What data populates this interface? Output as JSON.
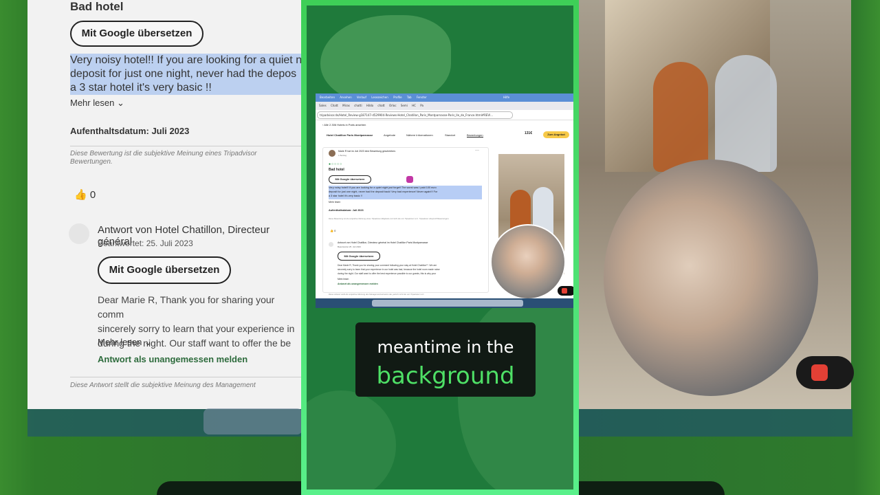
{
  "background_left": {
    "title": "Bad hotel",
    "translate_button": "Mit Google übersetzen",
    "review_lines": [
      "Very noisy hotel!! If you are looking for a quiet n",
      "deposit for just one night, never had the depos",
      "a 3 star hotel it's very basic !!"
    ],
    "read_more": "Mehr lesen",
    "stay_date": "Aufenthaltsdatum: Juli 2023",
    "disclaimer_lines": [
      "Diese Bewertung ist die subjektive Meinung eines Tripadvisor",
      "Bewertungen."
    ],
    "like_count": "0",
    "response_title": "Antwort von Hotel Chatillon, Directeur général",
    "response_date": "Beantwortet: 25. Juli 2023",
    "translate_button_2": "Mit Google übersetzen",
    "response_lines": [
      "Dear Marie R, Thank you for sharing your comm",
      "sincerely sorry to learn that your experience in",
      "during the night. Our staff want to offer the be"
    ],
    "read_more_2": "Mehr lesen",
    "report": "Antwort als unangemessen melden",
    "disclaimer_2": "Diese Antwort stellt die subjektive Meinung des Management"
  },
  "screenshot": {
    "menu_items": [
      "Bearbeiten",
      "Ansehen",
      "Verlauf",
      "Lesezeichen",
      "Profile",
      "Tab",
      "Fenster",
      "Hilfe"
    ],
    "tabs": [
      "Sales",
      "Chatt",
      "Miras",
      "chatti",
      "Hildo",
      "chatt",
      "Orloc",
      "Semi",
      "HC",
      "Pa"
    ],
    "url": "tripadvisor.de/Hotel_Review-g187147-d529904-Reviews-Hotel_Chatillon_Paris_Montparnasse-Paris_Ile_de_France.html#REVI...",
    "back_link": "Alle 2.306 Hotels in Paris ansehen",
    "hotel_name": "Hotel Chatillon Paris Montparnasse",
    "nav": [
      "Angebote",
      "Nähere Informationen",
      "Standort",
      "Bewertungen"
    ],
    "price": "131€",
    "cta": "Zum Angebot",
    "reviewer": "Marie R hat im Juli 2023 eine Bewertung geschrieben.",
    "contrib": "1 Beitrag",
    "title": "Bad hotel",
    "translate": "Mit Google übersetzen",
    "review_lines": [
      "Very noisy hotel!! If you are looking for a quiet night just forget! The worst was I paid 100 euro",
      "deposit for just one night, never had the deposit back! Very bad experience! Never again!!! For",
      "a 3 star hotel it's very basic !!"
    ],
    "read_more": "Mehr lesen",
    "stay_date": "Aufenthaltsdatum: Juli 2023",
    "disclaimer": "Diese Bewertung ist die subjektive Meinung eines Tripadvisor-Mitglieds und nicht die von Tripadvisor LLC. Tripadvisor überprüft Bewertungen.",
    "likes": "0",
    "response_title": "Antwort von Hotel Chatillon, Directeur général im Hotel Chatillon Paris Montparnasse",
    "response_date": "Beantwortet 25. Juli 2023",
    "translate_2": "Mit Google übersetzen",
    "response_lines": [
      "Dear Marie R, Thank you for sharing your comment following your stay at Hotel Chatillon**. We are",
      "sincerely sorry to learn that your experience in our hotel was bad, because the hotel room made noise",
      "during the night. Our staff want to offer the best experience possible to our guests, this is why your"
    ],
    "read_more_2": "Mehr lesen",
    "report": "Antwort als unangemessen melden",
    "footer_disclaimer": "Diese Antwort stellt die subjektive Meinung des Managementvertreters dar, jedoch nicht die von Tripadvisor LLC."
  },
  "caption": {
    "line1": "meantime in the",
    "line2": "background"
  },
  "colors": {
    "card_border": "#4be070",
    "card_bg": "#1f7a3b",
    "caption_accent": "#4ee066",
    "highlight": "#b7cdf5"
  }
}
